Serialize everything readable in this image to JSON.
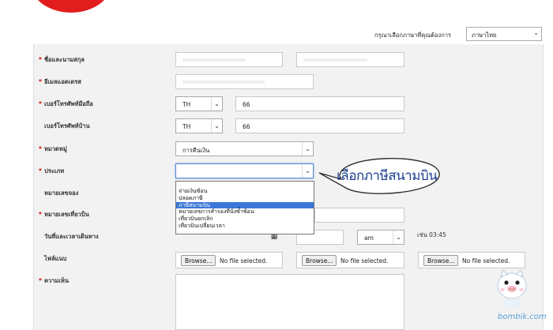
{
  "language": {
    "prompt": "กรุณาเลือกภาษาที่คุณต้องการ",
    "selected": "ภาษาไทย"
  },
  "form": {
    "fullname_label": "ชื่อและนามสกุล",
    "email_label": "อีเมลแอดเดรส",
    "mobile_label": "เบอร์โทรศัพท์มือถือ",
    "mobile_country": "TH",
    "mobile_prefix": "66",
    "home_phone_label": "เบอร์โทรศัพท์บ้าน",
    "home_country": "TH",
    "home_prefix": "66",
    "category_label": "หมวดหมู่",
    "category_value": "การคืนเงิน",
    "type_label": "ประเภท",
    "type_value": "",
    "booking_label": "หมายเลขจอง",
    "flight_label": "หมายเลขเที่ยวบิน",
    "departure_label": "วันที่และเวลาเดินทาง",
    "ampm_value": "am",
    "time_hint": "เช่น 03:45",
    "attachment_label": "ไฟล์แนบ",
    "browse_label": "Browse...",
    "no_file_text": "No file selected.",
    "comment_label": "ความเห็น",
    "required_mark": "*"
  },
  "type_options": [
    "",
    "จ่ายเงินซ้อน",
    "ปลอดภาษี",
    "ภาษีสนามบิน",
    "หมายเลขการสำรองที่นั่งซ้ำซ้อน",
    "เที่ยวบินยกเลิก",
    "เที่ยวบินเปลี่ยนเวลา"
  ],
  "type_options_selected_index": 3,
  "annotation": {
    "bubble_text": "เลือกภาษีสนามบิน"
  },
  "watermark": "bombik.com",
  "colors": {
    "required": "#d40000",
    "brand_red": "#e11d1d",
    "selected_option": "#3b77d8",
    "bubble_text": "#1a3d8f"
  }
}
